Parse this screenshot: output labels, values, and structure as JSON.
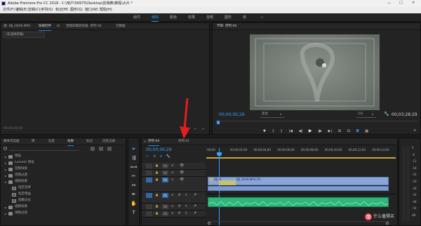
{
  "app": {
    "title": "Adobe Premiere Pro CC 2018 - C:\\用户\\56975\\Desktop\\剪辑教\\教程\\大片 *",
    "window_controls": {
      "minimize": "—",
      "maximize": "□",
      "close": "✕"
    }
  },
  "menu": [
    "文件(F)",
    "编辑(E)",
    "剪辑(C)",
    "序列(S)",
    "标记(M)",
    "图形(G)",
    "窗口(W)",
    "帮助(H)"
  ],
  "workspaces": {
    "items": [
      "组件",
      "编辑",
      "颜色",
      "效果",
      "音频",
      "图形",
      "库"
    ],
    "active_index": 1,
    "more": "»"
  },
  "source_panel": {
    "tabs": [
      "源: DJI_0036.MP4",
      "效果控件",
      "音频剪辑混合器: 序列 04",
      "元数据"
    ],
    "active_index": 1,
    "menu_icon": "≡",
    "no_clip_label": "(未选择剪辑)",
    "timecode": "00;00;00;00"
  },
  "program_monitor": {
    "tab": "节目: 序列 04",
    "timecode": "00;00;00;29",
    "fit": "适合",
    "quality": "1/2",
    "duration": "00;03;28;29"
  },
  "effects_panel": {
    "tabs": [
      "媒体浏览器",
      "库",
      "信息",
      "效果",
      "标记",
      "历史记录"
    ],
    "active_index": 3,
    "items": [
      {
        "type": "folder",
        "label": "预设",
        "expanded": false,
        "indent": 0
      },
      {
        "type": "folder",
        "label": "Lumetri 预设",
        "expanded": false,
        "indent": 0
      },
      {
        "type": "folder",
        "label": "音频效果",
        "expanded": false,
        "indent": 0
      },
      {
        "type": "folder",
        "label": "音频过渡",
        "expanded": false,
        "indent": 0
      },
      {
        "type": "folder",
        "label": "视频效果",
        "expanded": true,
        "indent": 0
      },
      {
        "type": "fx",
        "label": "恒定功率",
        "indent": 1
      },
      {
        "type": "fx",
        "label": "恒定增益",
        "indent": 1
      },
      {
        "type": "fx",
        "label": "指数淡化",
        "indent": 1
      },
      {
        "type": "folder",
        "label": "视频效果",
        "expanded": false,
        "indent": 0
      },
      {
        "type": "folder",
        "label": "视频过渡",
        "expanded": false,
        "indent": 0
      }
    ]
  },
  "tools": [
    "selection-tool",
    "track-select-tool",
    "ripple-edit-tool",
    "razor-tool",
    "slip-tool",
    "pen-tool",
    "hand-tool",
    "type-tool"
  ],
  "timeline": {
    "tabs": [
      "序列 04",
      "序列 01"
    ],
    "active_index": 0,
    "timecode": "00;00;00;29",
    "ruler": [
      ":00;00",
      "00;00;02;00",
      "00;00;04;00",
      "00;00;06;00",
      "00;00;08;00",
      "00;00;10;00",
      "00;00;12;00",
      "00;00;14;00"
    ],
    "video_tracks": [
      "V3",
      "V2",
      "V1"
    ],
    "audio_tracks": [
      "A1",
      "A2",
      "A3"
    ],
    "video_clip": "DJI_0036.MP4 [V]",
    "video_clip_short": "DJI_0",
    "audio_meter_labels": [
      "0",
      "-6",
      "-12",
      "-18",
      "-24",
      "-30",
      "-36",
      "-42",
      "-48",
      "-54",
      "dB"
    ]
  },
  "colors": {
    "accent_blue": "#2e8bd8",
    "video_clip": "#8aa6d8",
    "audio_clip": "#2db77a",
    "arrow": "#e0201c",
    "playhead": "#3aa0ff"
  },
  "watermark": "值 什么值得买"
}
